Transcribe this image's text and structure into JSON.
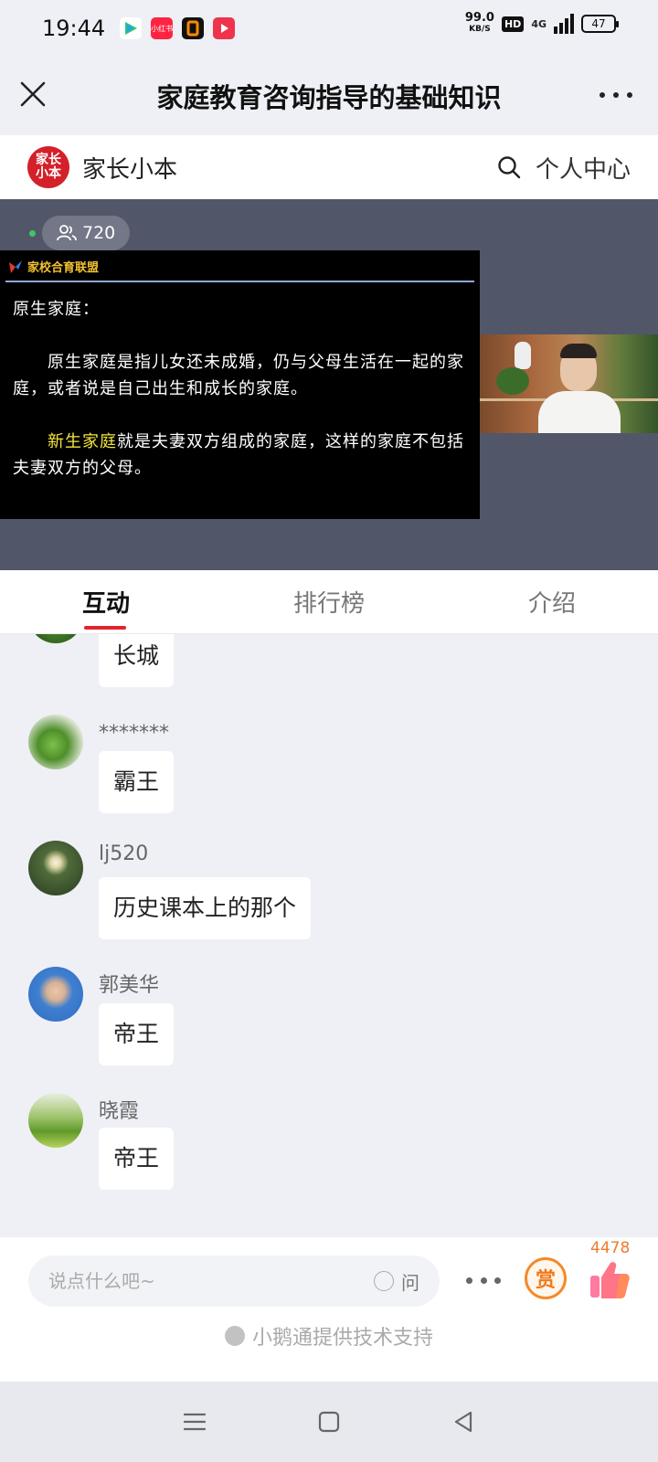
{
  "status_bar": {
    "time": "19:44",
    "net_speed_value": "99.0",
    "net_speed_unit": "KB/S",
    "hd": "HD",
    "network": "4G",
    "battery": "47",
    "app_icons": [
      "tencent-video-icon",
      "xiaohongshu-icon",
      "app-icon-orange",
      "video-app-icon"
    ]
  },
  "title_bar": {
    "title": "家庭教育咨询指导的基础知识"
  },
  "site_header": {
    "logo_text": "家长小本",
    "brand": "家长小本",
    "user_center": "个人中心"
  },
  "live": {
    "viewers": "720",
    "slide": {
      "org": "家校合育联盟",
      "heading": "原生家庭：",
      "para1": "　　原生家庭是指儿女还未成婚，仍与父母生活在一起的家庭，或者说是自己出生和成长的家庭。",
      "para2_highlight": "新生家庭",
      "para2_rest": "就是夫妻双方组成的家庭，这样的家庭不包括夫妻双方的父母。"
    }
  },
  "tabs": [
    {
      "label": "互动",
      "active": true
    },
    {
      "label": "排行榜",
      "active": false
    },
    {
      "label": "介绍",
      "active": false
    }
  ],
  "messages": [
    {
      "nick": "",
      "text": "长城"
    },
    {
      "nick": "*******",
      "text": "霸王"
    },
    {
      "nick": "lj520",
      "text": "历史课本上的那个"
    },
    {
      "nick": "郭美华",
      "text": "帝王"
    },
    {
      "nick": "晓霞",
      "text": "帝王"
    }
  ],
  "input": {
    "placeholder": "说点什么吧~",
    "ask_label": "问",
    "reward_label": "赏",
    "like_count": "4478",
    "powered_by": "小鹅通提供技术支持"
  },
  "colors": {
    "accent_red": "#e2252d",
    "reward_orange": "#f07a1c",
    "slide_highlight": "#f5e63a"
  }
}
